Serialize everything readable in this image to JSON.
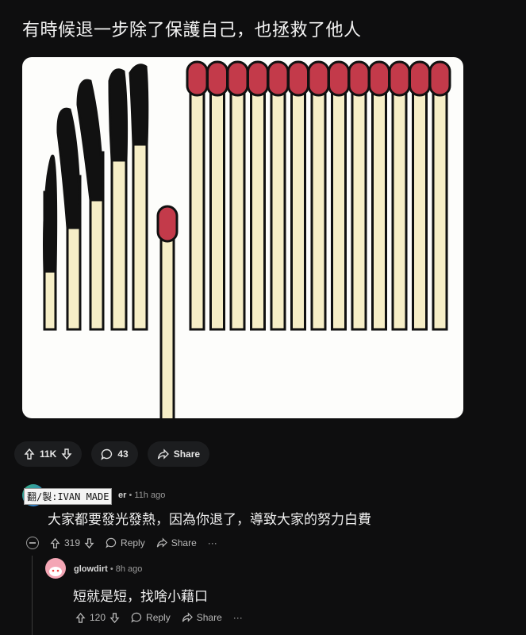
{
  "post": {
    "title": "有時候退一步除了保護自己，也拯救了他人",
    "image_alt": "matches illustration",
    "votes": "11K",
    "comments": "43",
    "share_label": "Share"
  },
  "comments": [
    {
      "author_partial": "er",
      "watermark": "翻/製:IVAN MADE",
      "time": "11h ago",
      "text": "大家都要發光發熱，因為你退了，導致大家的努力白費",
      "votes": "319",
      "reply_label": "Reply",
      "share_label": "Share",
      "more": "···"
    },
    {
      "author": "glowdirt",
      "time": "8h ago",
      "text": "短就是短，找啥小藉口",
      "votes": "120",
      "reply_label": "Reply",
      "share_label": "Share",
      "more": "···"
    }
  ],
  "icons": {
    "upvote": "arrow-up-icon",
    "downvote": "arrow-down-icon",
    "comment": "speech-bubble-icon",
    "share": "share-arrow-icon",
    "collapse": "minus-circle-icon"
  },
  "colors": {
    "background": "#0e0e0f",
    "match_head": "#c33a4a",
    "match_stick": "#f6eec7",
    "burnt": "#111111"
  }
}
